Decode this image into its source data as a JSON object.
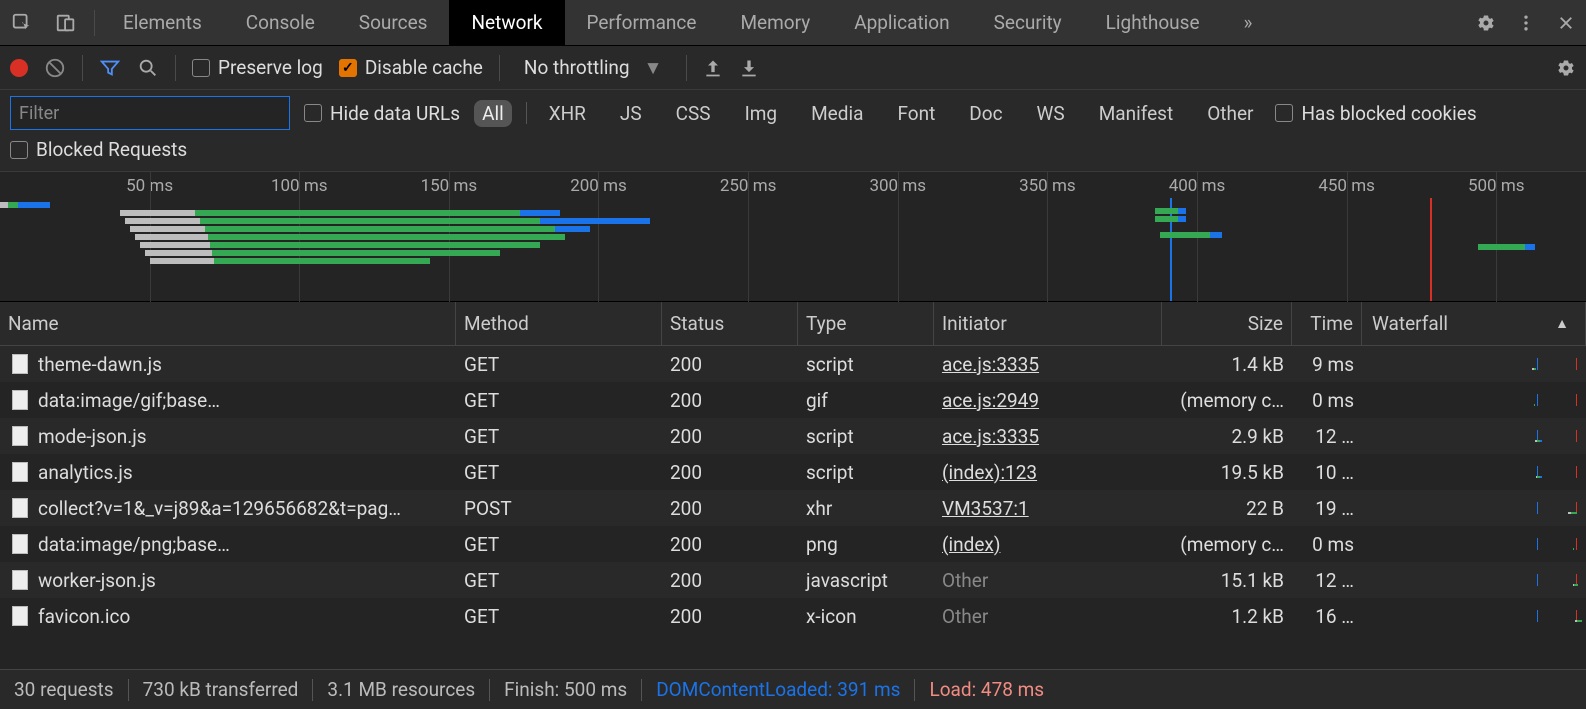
{
  "tabs": [
    "Elements",
    "Console",
    "Sources",
    "Network",
    "Performance",
    "Memory",
    "Application",
    "Security",
    "Lighthouse"
  ],
  "active_tab": "Network",
  "more_tabs_glyph": "»",
  "toolbar": {
    "preserve_log_label": "Preserve log",
    "preserve_log_checked": false,
    "disable_cache_label": "Disable cache",
    "disable_cache_checked": true,
    "throttling_label": "No throttling"
  },
  "filter": {
    "placeholder": "Filter",
    "hide_data_urls_label": "Hide data URLs",
    "hide_data_urls_checked": false,
    "types": [
      "All",
      "XHR",
      "JS",
      "CSS",
      "Img",
      "Media",
      "Font",
      "Doc",
      "WS",
      "Manifest",
      "Other"
    ],
    "active_type": "All",
    "has_blocked_cookies_label": "Has blocked cookies",
    "has_blocked_cookies_checked": false,
    "blocked_requests_label": "Blocked Requests",
    "blocked_requests_checked": false
  },
  "overview": {
    "ticks_ms": [
      50,
      100,
      150,
      200,
      250,
      300,
      350,
      400,
      450,
      500
    ],
    "max_ms": 530,
    "dcl_ms": 391,
    "load_ms": 478,
    "bars": [
      {
        "y": 30,
        "wait_start": 0,
        "wait_end": 8,
        "dl_start": 8,
        "dl_end": 18,
        "blue_start": 18,
        "blue_end": 50
      },
      {
        "y": 38,
        "wait_start": 120,
        "wait_end": 195,
        "dl_start": 195,
        "dl_end": 520,
        "blue_start": 520,
        "blue_end": 560
      },
      {
        "y": 46,
        "wait_start": 125,
        "wait_end": 200,
        "dl_start": 200,
        "dl_end": 540,
        "blue_start": 540,
        "blue_end": 650
      },
      {
        "y": 54,
        "wait_start": 130,
        "wait_end": 205,
        "dl_start": 205,
        "dl_end": 555,
        "blue_start": 555,
        "blue_end": 590
      },
      {
        "y": 62,
        "wait_start": 135,
        "wait_end": 208,
        "dl_start": 208,
        "dl_end": 565
      },
      {
        "y": 70,
        "wait_start": 140,
        "wait_end": 210,
        "dl_start": 210,
        "dl_end": 540
      },
      {
        "y": 78,
        "wait_start": 145,
        "wait_end": 212,
        "dl_start": 212,
        "dl_end": 500
      },
      {
        "y": 86,
        "wait_start": 150,
        "wait_end": 214,
        "dl_start": 214,
        "dl_end": 430
      }
    ],
    "bars_right": [
      {
        "y": 36,
        "dl_start": 1155,
        "dl_end": 1180,
        "blue_start": 1178,
        "blue_end": 1186
      },
      {
        "y": 44,
        "dl_start": 1155,
        "dl_end": 1180,
        "blue_start": 1178,
        "blue_end": 1186
      },
      {
        "y": 60,
        "dl_start": 1160,
        "dl_end": 1210,
        "blue_start": 1210,
        "blue_end": 1222
      },
      {
        "y": 72,
        "dl_start": 1478,
        "dl_end": 1525,
        "blue_start": 1525,
        "blue_end": 1535
      }
    ]
  },
  "columns": {
    "name": "Name",
    "method": "Method",
    "status": "Status",
    "type": "Type",
    "initiator": "Initiator",
    "size": "Size",
    "time": "Time",
    "waterfall": "Waterfall"
  },
  "waterfall": {
    "max_ms": 500,
    "dcl_ms": 391,
    "load_ms": 478
  },
  "requests": [
    {
      "name": "theme-dawn.js",
      "method": "GET",
      "status": "200",
      "type": "script",
      "initiator": "ace.js:3335",
      "initiator_link": true,
      "size": "1.4 kB",
      "time": "9 ms",
      "wf": {
        "start": 380,
        "wait": 3,
        "dl": 6
      }
    },
    {
      "name": "data:image/gif;base…",
      "method": "GET",
      "status": "200",
      "status_dim": true,
      "type": "gif",
      "initiator": "ace.js:2949",
      "initiator_link": true,
      "size": "(memory c…",
      "time": "0 ms",
      "wf": {
        "start": 385,
        "wait": 0,
        "dl": 2
      }
    },
    {
      "name": "mode-json.js",
      "method": "GET",
      "status": "200",
      "type": "script",
      "initiator": "ace.js:3335",
      "initiator_link": true,
      "size": "2.9 kB",
      "time": "12 …",
      "wf": {
        "start": 386,
        "wait": 4,
        "dl": 8,
        "tail": 4
      }
    },
    {
      "name": "analytics.js",
      "method": "GET",
      "status": "200",
      "type": "script",
      "initiator": "(index):123",
      "initiator_link": true,
      "size": "19.5 kB",
      "time": "10 …",
      "wf": {
        "start": 388,
        "wait": 3,
        "dl": 7,
        "tail": 4
      }
    },
    {
      "name": "collect?v=1&_v=j89&a=129656682&t=pag…",
      "method": "POST",
      "status": "200",
      "type": "xhr",
      "initiator": "VM3537:1",
      "initiator_link": true,
      "size": "22 B",
      "time": "19 …",
      "wf": {
        "start": 460,
        "wait": 6,
        "dl": 13
      }
    },
    {
      "name": "data:image/png;base…",
      "method": "GET",
      "status": "200",
      "status_dim": true,
      "type": "png",
      "initiator": "(index)",
      "initiator_link": true,
      "size": "(memory c…",
      "time": "0 ms",
      "wf": {
        "start": 470,
        "wait": 0,
        "dl": 2
      }
    },
    {
      "name": "worker-json.js",
      "method": "GET",
      "status": "200",
      "type": "javascript",
      "initiator": "Other",
      "initiator_link": false,
      "size": "15.1 kB",
      "time": "12 …",
      "wf": {
        "start": 470,
        "wait": 4,
        "dl": 8
      }
    },
    {
      "name": "favicon.ico",
      "method": "GET",
      "status": "200",
      "type": "x-icon",
      "initiator": "Other",
      "initiator_link": false,
      "size": "1.2 kB",
      "time": "16 …",
      "wf": {
        "start": 475,
        "wait": 5,
        "dl": 11
      }
    }
  ],
  "status_bar": {
    "requests": "30 requests",
    "transferred": "730 kB transferred",
    "resources": "3.1 MB resources",
    "finish": "Finish: 500 ms",
    "dcl": "DOMContentLoaded: 391 ms",
    "load": "Load: 478 ms"
  }
}
